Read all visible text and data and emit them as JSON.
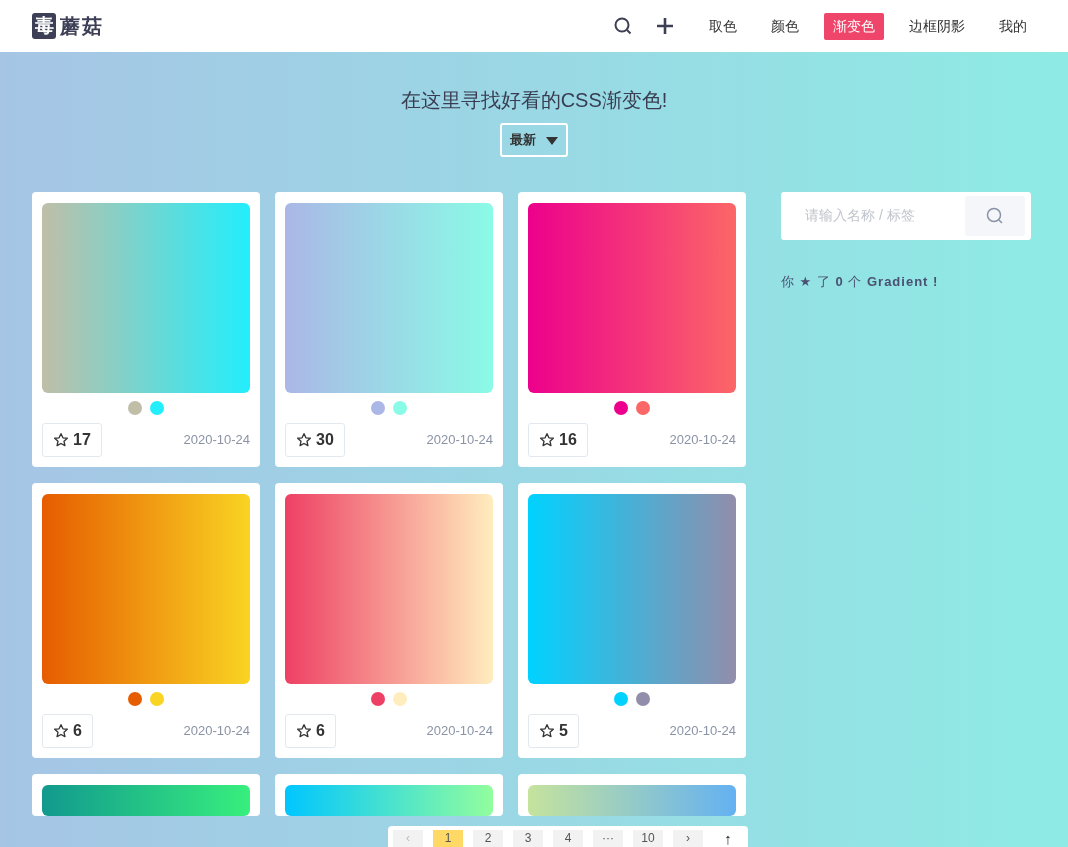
{
  "logo": {
    "mark": "毒",
    "name": "蘑菇"
  },
  "nav": [
    {
      "label": "取色",
      "selected": false
    },
    {
      "label": "颜色",
      "selected": false
    },
    {
      "label": "渐变色",
      "selected": true
    },
    {
      "label": "边框阴影",
      "selected": false
    },
    {
      "label": "我的",
      "selected": false
    }
  ],
  "headline": "在这里寻找好看的CSS渐变色!",
  "sort": {
    "label": "最新"
  },
  "cards": [
    {
      "stops": [
        {
          "color": "#c0bea7"
        },
        {
          "color": "#22eefc"
        }
      ],
      "likes": "17",
      "date": "2020-10-24"
    },
    {
      "stops": [
        {
          "color": "#abb7e6"
        },
        {
          "color": "#8afbe6"
        }
      ],
      "likes": "30",
      "date": "2020-10-24"
    },
    {
      "stops": [
        {
          "color": "#ec008c"
        },
        {
          "color": "#fc6767"
        }
      ],
      "likes": "16",
      "date": "2020-10-24"
    },
    {
      "stops": [
        {
          "color": "#e65c00"
        },
        {
          "color": "#f9d423"
        }
      ],
      "likes": "6",
      "date": "2020-10-24"
    },
    {
      "stops": [
        {
          "color": "#ee4064"
        },
        {
          "color": "#ffedbe"
        }
      ],
      "likes": "6",
      "date": "2020-10-24"
    },
    {
      "stops": [
        {
          "color": "#00d2ff"
        },
        {
          "color": "#928dab"
        }
      ],
      "likes": "5",
      "date": "2020-10-24"
    },
    {
      "stops": [
        {
          "color": "#11998e"
        },
        {
          "color": "#38ef7d"
        }
      ]
    },
    {
      "stops": [
        {
          "color": "#00c6ff"
        },
        {
          "color": "#92fe9d"
        }
      ]
    },
    {
      "stops": [
        {
          "color": "#c5e39d"
        },
        {
          "color": "#64b1f2"
        }
      ]
    }
  ],
  "search": {
    "placeholder": "请输入名称 / 标签"
  },
  "starred_note": "你 ★ 了 **0** 个 **Gradient !**",
  "pagination": [
    {
      "label": "‹",
      "kind": "prev",
      "selected": false
    },
    {
      "label": "1",
      "kind": "page",
      "selected": true
    },
    {
      "label": "2",
      "kind": "page",
      "selected": false
    },
    {
      "label": "3",
      "kind": "page",
      "selected": false
    },
    {
      "label": "4",
      "kind": "page",
      "selected": false
    },
    {
      "label": "···",
      "kind": "page",
      "selected": false
    },
    {
      "label": "10",
      "kind": "page",
      "selected": false
    },
    {
      "label": "›",
      "kind": "next",
      "selected": false
    },
    {
      "label": "↑",
      "kind": "top"
    }
  ]
}
